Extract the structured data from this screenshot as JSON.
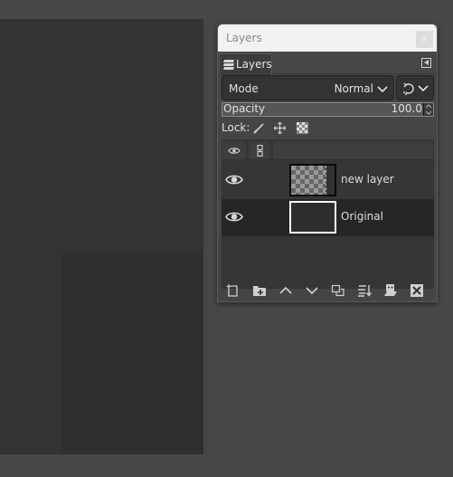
{
  "dialog": {
    "title": "Layers",
    "close_label": "x",
    "tab_label": "Layers",
    "tab_icon": "layers-icon",
    "tab_menu_icon": "tab-menu-icon"
  },
  "mode": {
    "label": "Mode",
    "value": "Normal",
    "composite_icon": "composite-mode-icon"
  },
  "opacity": {
    "label": "Opacity",
    "value": "100.0"
  },
  "lock": {
    "label": "Lock:",
    "items": [
      "lock-pixels-icon",
      "lock-position-icon",
      "lock-alpha-icon"
    ]
  },
  "columns": [
    "visibility-column",
    "chain-column",
    "layer-column"
  ],
  "layers": [
    {
      "name": "new layer",
      "visible": true,
      "thumbnail": "transparent",
      "selected": false
    },
    {
      "name": "Original",
      "visible": true,
      "thumbnail": "dark",
      "selected": true
    }
  ],
  "toolbar": [
    "new-layer-icon",
    "new-layer-group-icon",
    "raise-layer-icon",
    "lower-layer-icon",
    "duplicate-layer-icon",
    "merge-layer-icon",
    "layer-mask-icon",
    "delete-layer-icon"
  ],
  "colors": {
    "background": "#474747",
    "canvas": "#333333",
    "selected_row": "#262626",
    "titlebar": "#f2f2f2"
  }
}
